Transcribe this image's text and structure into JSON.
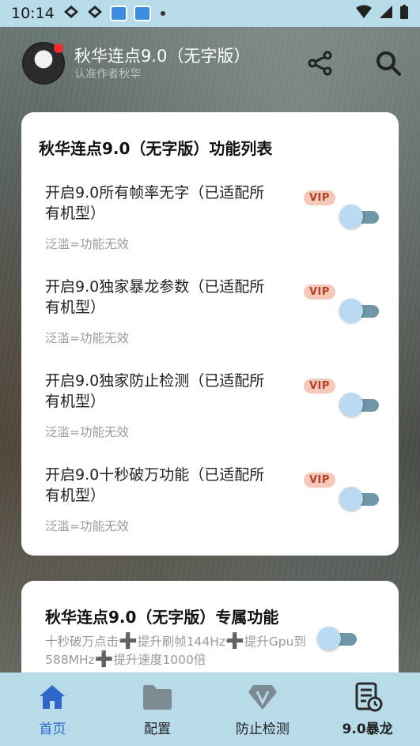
{
  "status_bar": {
    "time": "10:14"
  },
  "header": {
    "title": "秋华连点9.0（无字版）",
    "subtitle": "认准作者秋华"
  },
  "main_card": {
    "title": "秋华连点9.0（无字版）功能列表",
    "items": [
      {
        "title": "开启9.0所有帧率无字（已适配所有机型）",
        "badge": "VIP",
        "note": "泛滥=功能无效",
        "enabled": false
      },
      {
        "title": "开启9.0独家暴龙参数（已适配所有机型）",
        "badge": "VIP",
        "note": "泛滥=功能无效",
        "enabled": false
      },
      {
        "title": "开启9.0独家防止检测（已适配所有机型）",
        "badge": "VIP",
        "note": "泛滥=功能无效",
        "enabled": false
      },
      {
        "title": "开启9.0十秒破万功能（已适配所有机型）",
        "badge": "VIP",
        "note": "泛滥=功能无效",
        "enabled": false
      }
    ]
  },
  "exclusive_card": {
    "title": "秋华连点9.0（无字版）专属功能",
    "desc_parts": [
      "十秒破万点击",
      "提升刷帧144Hz",
      "提升Gpu到588MHz",
      "提升速度1000倍"
    ],
    "plus": "➕",
    "enabled": false
  },
  "bottom_nav": [
    {
      "label": "首页",
      "icon": "home-icon",
      "active": true
    },
    {
      "label": "配置",
      "icon": "folder-icon",
      "active": false
    },
    {
      "label": "防止检测",
      "icon": "vip-diamond-icon",
      "active": false
    },
    {
      "label": "9.0暴龙",
      "icon": "report-clock-icon",
      "active": false
    }
  ],
  "colors": {
    "status_bar_bg": "#b7dbe9",
    "nav_active": "#2f66c8",
    "vip_bg": "#f6c8b8",
    "vip_text": "#b2402c",
    "switch_track": "#6f96a6",
    "switch_thumb": "#b9daf2",
    "plus_orange": "#f07a1e"
  }
}
